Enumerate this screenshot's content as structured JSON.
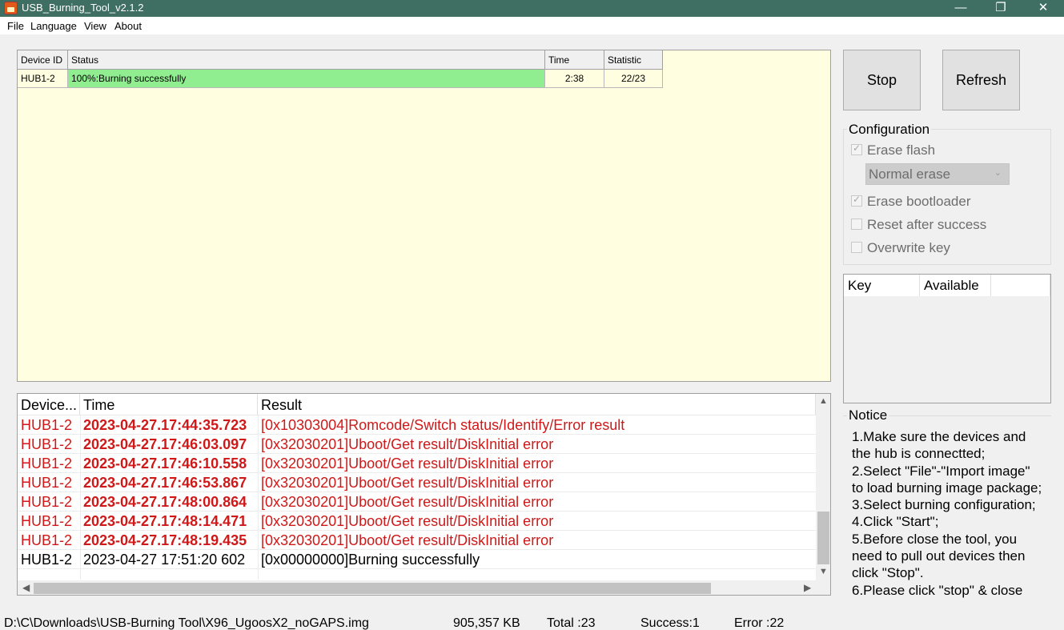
{
  "window": {
    "title": "USB_Burning_Tool_v2.1.2",
    "controls": {
      "minimize": "—",
      "maximize": "❐",
      "close": "✕"
    }
  },
  "menu": [
    "File",
    "Language",
    "View",
    "About"
  ],
  "device_grid": {
    "columns": [
      "Device ID",
      "Status",
      "Time",
      "Statistic"
    ],
    "rows": [
      {
        "device_id": "HUB1-2",
        "status": "100%:Burning successfully",
        "time": "2:38",
        "statistic": "22/23"
      }
    ],
    "colors": {
      "background": "#fffee0",
      "status_success": "#90ee90"
    }
  },
  "buttons": {
    "stop": "Stop",
    "refresh": "Refresh"
  },
  "configuration": {
    "title": "Configuration",
    "erase_flash": {
      "label": "Erase flash",
      "checked": true
    },
    "erase_mode": "Normal erase",
    "erase_bootloader": {
      "label": "Erase bootloader",
      "checked": true
    },
    "reset_after_success": {
      "label": "Reset after success",
      "checked": false
    },
    "overwrite_key": {
      "label": "Overwrite key",
      "checked": false
    }
  },
  "key_list": {
    "columns": [
      "Key",
      "Available"
    ]
  },
  "log": {
    "columns": [
      "Device...",
      "Time",
      "Result"
    ],
    "rows": [
      {
        "device": "HUB1-2",
        "time": "2023-04-27.17:44:35.723",
        "result": "[0x10303004]Romcode/Switch status/Identify/Error result",
        "error": true
      },
      {
        "device": "HUB1-2",
        "time": "2023-04-27.17:46:03.097",
        "result": "[0x32030201]Uboot/Get result/DiskInitial error",
        "error": true
      },
      {
        "device": "HUB1-2",
        "time": "2023-04-27.17:46:10.558",
        "result": "[0x32030201]Uboot/Get result/DiskInitial error",
        "error": true
      },
      {
        "device": "HUB1-2",
        "time": "2023-04-27.17:46:53.867",
        "result": "[0x32030201]Uboot/Get result/DiskInitial error",
        "error": true
      },
      {
        "device": "HUB1-2",
        "time": "2023-04-27.17:48:00.864",
        "result": "[0x32030201]Uboot/Get result/DiskInitial error",
        "error": true
      },
      {
        "device": "HUB1-2",
        "time": "2023-04-27.17:48:14.471",
        "result": "[0x32030201]Uboot/Get result/DiskInitial error",
        "error": true
      },
      {
        "device": "HUB1-2",
        "time": "2023-04-27.17:48:19.435",
        "result": "[0x32030201]Uboot/Get result/DiskInitial error",
        "error": true
      },
      {
        "device": "HUB1-2",
        "time": "2023-04-27 17:51:20 602",
        "result": "[0x00000000]Burning successfully",
        "error": false
      }
    ],
    "colors": {
      "error_text": "#d01818"
    }
  },
  "notice": {
    "title": "Notice",
    "lines": [
      "1.Make sure the devices and",
      "the hub is connectted;",
      "2.Select \"File\"-\"Import image\"",
      "to load burning image package;",
      "3.Select burning configuration;",
      "4.Click \"Start\";",
      "5.Before close the tool, you",
      "need to pull out devices then",
      "click \"Stop\".",
      "6.Please click \"stop\" & close"
    ]
  },
  "status_bar": {
    "image_path": "D:\\C\\Downloads\\USB-Burning Tool\\X96_UgoosX2_noGAPS.img",
    "size": "905,357 KB",
    "total": "Total :23",
    "success": "Success:1",
    "error": "Error :22"
  }
}
